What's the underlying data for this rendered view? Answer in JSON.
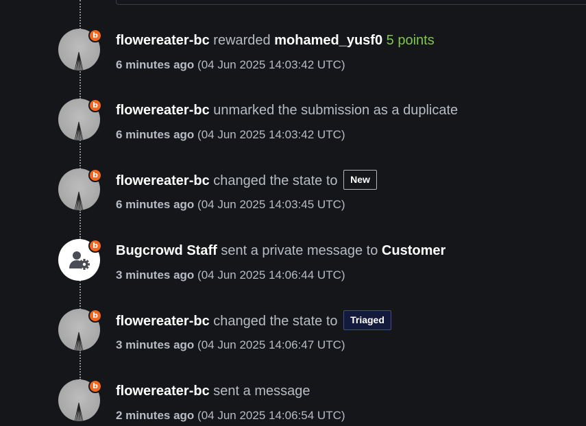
{
  "events": [
    {
      "actor": "flowereater-bc",
      "action": "rewarded",
      "target": "mohamed_yusf0",
      "points": "5 points",
      "relative_time": "6 minutes ago",
      "timestamp": "(04 Jun 2025 14:03:42 UTC)",
      "badge": "b"
    },
    {
      "actor": "flowereater-bc",
      "action": "unmarked the submission as a duplicate",
      "relative_time": "6 minutes ago",
      "timestamp": "(04 Jun 2025 14:03:42 UTC)",
      "badge": "b"
    },
    {
      "actor": "flowereater-bc",
      "action": "changed the state to",
      "state": "New",
      "relative_time": "6 minutes ago",
      "timestamp": "(04 Jun 2025 14:03:45 UTC)",
      "badge": "b"
    },
    {
      "actor": "Bugcrowd Staff",
      "action": "sent a private message to",
      "target": "Customer",
      "relative_time": "3 minutes ago",
      "timestamp": "(04 Jun 2025 14:06:44 UTC)",
      "badge": "b",
      "avatar_icon": "user-gear-icon"
    },
    {
      "actor": "flowereater-bc",
      "action": "changed the state to",
      "state": "Triaged",
      "relative_time": "3 minutes ago",
      "timestamp": "(04 Jun 2025 14:06:47 UTC)",
      "badge": "b"
    },
    {
      "actor": "flowereater-bc",
      "action": "sent a message",
      "relative_time": "2 minutes ago",
      "timestamp": "(04 Jun 2025 14:06:54 UTC)",
      "badge": "b"
    }
  ],
  "colors": {
    "background": "#14161a",
    "badge": "#f26822",
    "points": "#7ec850",
    "muted_text": "#b8bcc3",
    "triaged_border": "#3f4a9a"
  }
}
